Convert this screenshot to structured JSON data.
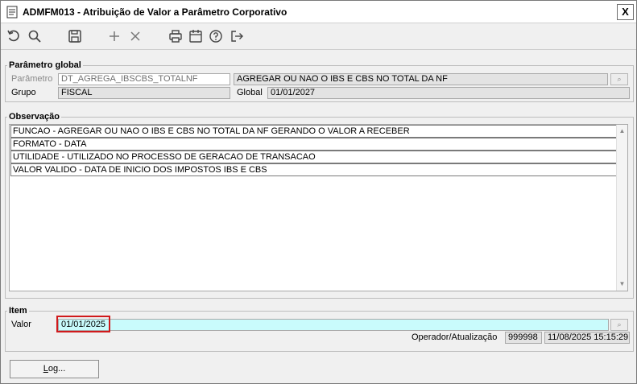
{
  "window": {
    "title": "ADMFM013 - Atribuição de Valor a Parâmetro Corporativo",
    "close_label": "X"
  },
  "toolbar": {
    "buttons": [
      {
        "name": "undo-icon"
      },
      {
        "name": "search-icon"
      },
      {
        "name": "save-icon"
      },
      {
        "name": "add-icon"
      },
      {
        "name": "delete-icon"
      },
      {
        "name": "print-icon"
      },
      {
        "name": "calendar-icon"
      },
      {
        "name": "help-icon"
      },
      {
        "name": "exit-icon"
      }
    ]
  },
  "parametro_global": {
    "legend": "Parâmetro global",
    "parametro_label": "Parâmetro",
    "parametro_value": "DT_AGREGA_IBSCBS_TOTALNF",
    "parametro_desc": "AGREGAR OU NAO O IBS E CBS NO TOTAL DA NF",
    "grupo_label": "Grupo",
    "grupo_value": "FISCAL",
    "global_label": "Global",
    "global_value": "01/01/2027"
  },
  "observacao": {
    "legend": "Observação",
    "lines": [
      "FUNCAO - AGREGAR OU NAO O IBS E CBS NO TOTAL DA NF GERANDO O VALOR A RECEBER",
      "FORMATO - DATA",
      "UTILIDADE - UTILIZADO NO PROCESSO DE GERACAO DE TRANSACAO",
      "VALOR VALIDO - DATA DE INICIO DOS IMPOSTOS IBS E CBS"
    ]
  },
  "item": {
    "legend": "Item",
    "valor_label": "Valor",
    "valor_value": "01/01/2025",
    "operador_label": "Operador/Atualização",
    "operador_value": "999998",
    "atualizacao_value": "11/08/2025 15:15:29"
  },
  "footer": {
    "log_prefix": "L",
    "log_rest": "og..."
  },
  "colors": {
    "highlight": "#d0191b",
    "valor_bg": "#c9fbfc"
  }
}
